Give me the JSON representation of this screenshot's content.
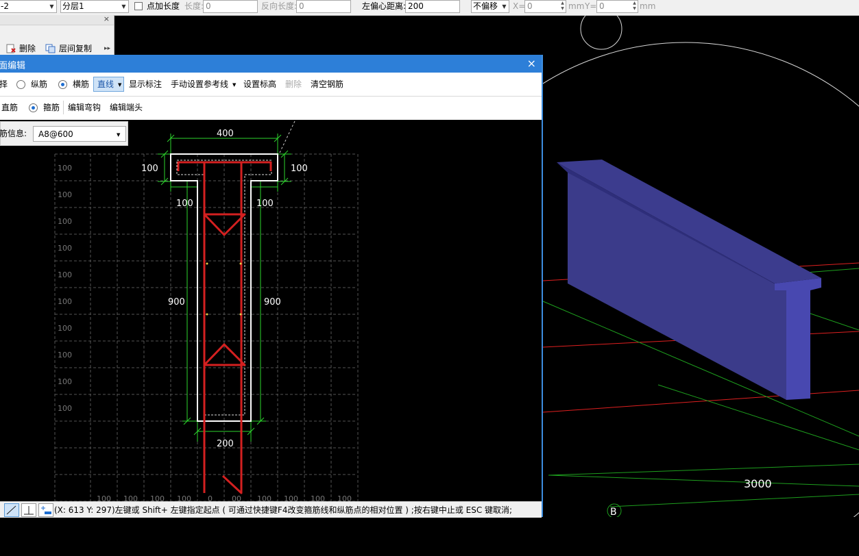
{
  "toolbar": {
    "component_combo": "-2",
    "layer_combo": "分层1",
    "add_length_label": "点加长度",
    "length_label": "长度:",
    "length_value": "0",
    "reverse_length_label": "反向长度:",
    "reverse_length_value": "0",
    "left_offset_label": "左偏心距离:",
    "left_offset_value": "200",
    "offset_combo": "不偏移",
    "x_label": "X=",
    "x_value": "0",
    "mm1": "mm",
    "y_label": "Y=",
    "y_value": "0",
    "mm2": "mm"
  },
  "left_panel": {
    "delete_label": "删除",
    "copy_label": "层间复制"
  },
  "dialog": {
    "title": "面编辑",
    "close": "×",
    "row1": {
      "choose": "择",
      "longitudinal": "纵筋",
      "transverse": "横筋",
      "line_dropdown": "直线",
      "show_labels": "显示标注",
      "manual_ref": "手动设置参考线",
      "set_elevation": "设置标高",
      "delete": "删除",
      "clear_rebar": "清空钢筋"
    },
    "row2": {
      "straight": "直筋",
      "stirrup": "箍筋",
      "edit_hook": "编辑弯钩",
      "edit_end": "编辑端头"
    },
    "rebar_info_label": "筋信息:",
    "rebar_info_value": "A8@600"
  },
  "drawing": {
    "dim_top": "400",
    "dim_flange_left": "100",
    "dim_flange_right": "100",
    "dim_web_left_step": "100",
    "dim_web_right_step": "100",
    "dim_web_left_height": "900",
    "dim_web_right_height": "900",
    "dim_bottom": "200",
    "grid_row_labels": [
      "100",
      "100",
      "100",
      "100",
      "100",
      "100",
      "100",
      "100",
      "100",
      "100"
    ],
    "grid_col_labels": [
      "100",
      "100",
      "100",
      "100",
      "00",
      "100",
      "100",
      "100",
      "100"
    ],
    "grid_col_extra": "0"
  },
  "status": {
    "message": "(X: 613 Y: 297)左键或 Shift+ 左键指定起点 ( 可通过快捷键F4改变箍筋线和纵筋点的相对位置 ) ;按右键中止或 ESC 键取消;"
  },
  "viewport3d": {
    "dimension": "3000",
    "axis_label": "B",
    "beam_color": "#3a3a8c"
  }
}
